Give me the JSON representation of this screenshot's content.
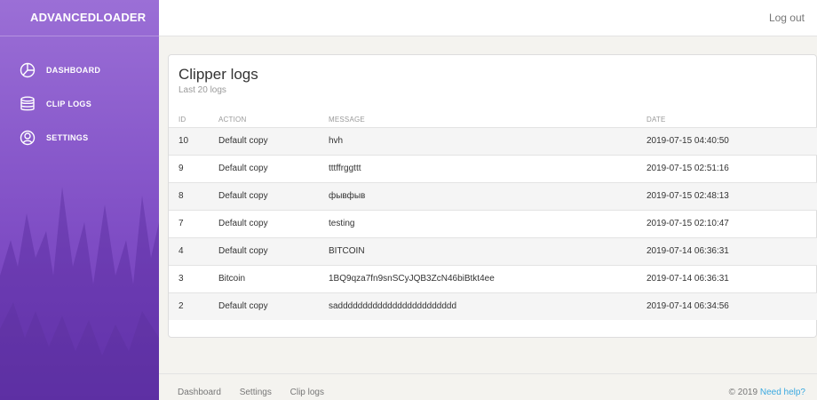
{
  "app": {
    "brand": "ADVANCEDLOADER"
  },
  "sidebar": {
    "items": [
      {
        "label": "DASHBOARD",
        "icon": "pie-chart-icon"
      },
      {
        "label": "CLIP LOGS",
        "icon": "database-icon"
      },
      {
        "label": "SETTINGS",
        "icon": "user-circle-icon"
      }
    ]
  },
  "header": {
    "logout": "Log out"
  },
  "card": {
    "title": "Clipper logs",
    "subtitle": "Last 20 logs",
    "columns": [
      "ID",
      "ACTION",
      "MESSAGE",
      "DATE"
    ],
    "rows": [
      {
        "id": "10",
        "action": "Default copy",
        "message": "hvh",
        "date": "2019-07-15 04:40:50"
      },
      {
        "id": "9",
        "action": "Default copy",
        "message": "tttffrggttt",
        "date": "2019-07-15 02:51:16"
      },
      {
        "id": "8",
        "action": "Default copy",
        "message": "фывфыв",
        "date": "2019-07-15 02:48:13"
      },
      {
        "id": "7",
        "action": "Default copy",
        "message": "testing",
        "date": "2019-07-15 02:10:47"
      },
      {
        "id": "4",
        "action": "Default copy",
        "message": "BITCOIN",
        "date": "2019-07-14 06:36:31"
      },
      {
        "id": "3",
        "action": "Bitcoin",
        "message": "1BQ9qza7fn9snSCyJQB3ZcN46biBtkt4ee",
        "date": "2019-07-14 06:36:31"
      },
      {
        "id": "2",
        "action": "Default copy",
        "message": "sadddddddddddddddddddddddd",
        "date": "2019-07-14 06:34:56"
      }
    ]
  },
  "footer": {
    "links": [
      "Dashboard",
      "Settings",
      "Clip logs"
    ],
    "copyright": "© 2019",
    "help": "Need help?"
  },
  "colors": {
    "sidebar": "#8a5bcc",
    "link": "#3aa9e0"
  }
}
